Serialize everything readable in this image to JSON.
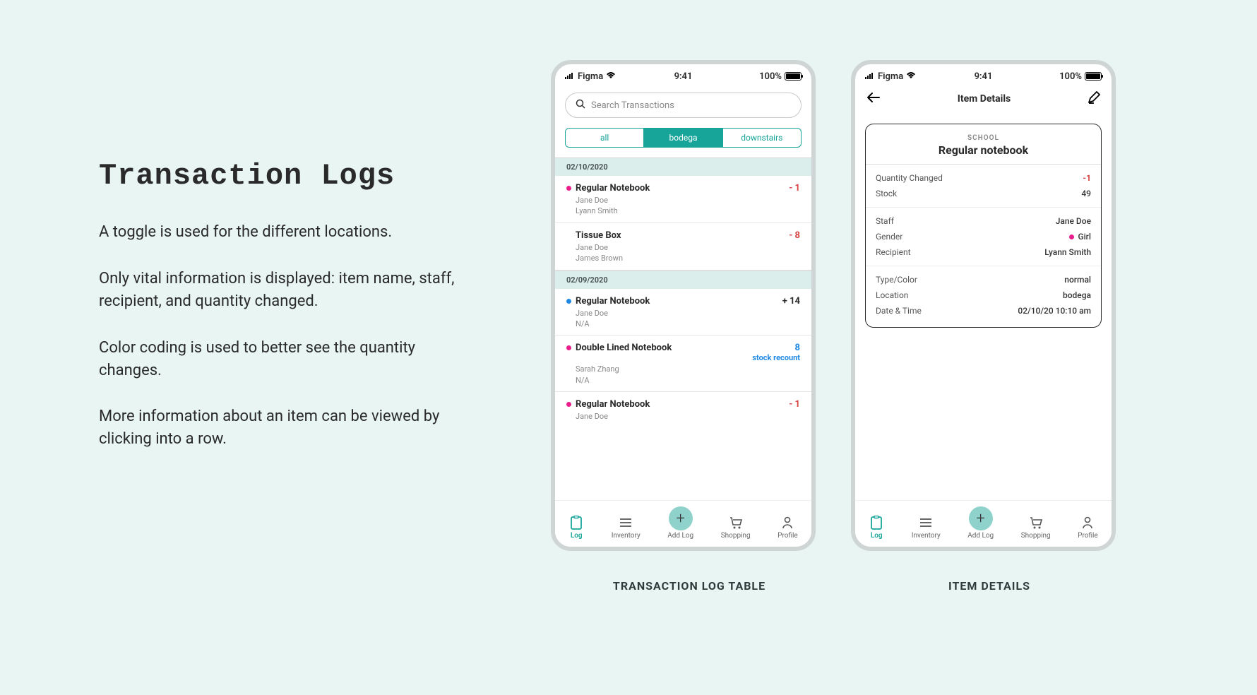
{
  "description": {
    "heading": "Transaction Logs",
    "p1": "A toggle is used for the different locations.",
    "p2": "Only vital information is displayed: item name, staff, recipient, and quantity changed.",
    "p3": "Color coding is used to better see the quantity changes.",
    "p4": "More information about an item can be viewed by clicking into a row."
  },
  "status": {
    "carrier": "Figma",
    "time": "9:41",
    "battery": "100%"
  },
  "search": {
    "placeholder": "Search Transactions"
  },
  "segments": {
    "all": "all",
    "bodega": "bodega",
    "downstairs": "downstairs"
  },
  "logs": {
    "date1": "02/10/2020",
    "date2": "02/09/2020",
    "r1": {
      "title": "Regular Notebook",
      "staff": "Jane Doe",
      "recipient": "Lyann Smith",
      "qty": "- 1"
    },
    "r2": {
      "title": "Tissue Box",
      "staff": "Jane Doe",
      "recipient": "James Brown",
      "qty": "- 8"
    },
    "r3": {
      "title": "Regular Notebook",
      "staff": "Jane Doe",
      "recipient": "N/A",
      "qty": "+ 14"
    },
    "r4": {
      "title": "Double Lined Notebook",
      "staff": "Sarah Zhang",
      "recipient": "N/A",
      "qty": "8",
      "note": "stock recount"
    },
    "r5": {
      "title": "Regular Notebook",
      "staff": "Jane Doe",
      "qty": "- 1"
    }
  },
  "nav": {
    "log": "Log",
    "inventory": "Inventory",
    "add": "Add Log",
    "shopping": "Shopping",
    "profile": "Profile"
  },
  "details": {
    "header": "Item Details",
    "category": "SCHOOL",
    "itemName": "Regular notebook",
    "qtyChangedLabel": "Quantity Changed",
    "qtyChanged": "-1",
    "stockLabel": "Stock",
    "stock": "49",
    "staffLabel": "Staff",
    "staff": "Jane Doe",
    "genderLabel": "Gender",
    "gender": "Girl",
    "recipientLabel": "Recipient",
    "recipient": "Lyann Smith",
    "typeLabel": "Type/Color",
    "type": "normal",
    "locationLabel": "Location",
    "location": "bodega",
    "dateTimeLabel": "Date & Time",
    "dateTime": "02/10/20  10:10 am"
  },
  "captions": {
    "left": "TRANSACTION LOG TABLE",
    "right": "ITEM DETAILS"
  }
}
